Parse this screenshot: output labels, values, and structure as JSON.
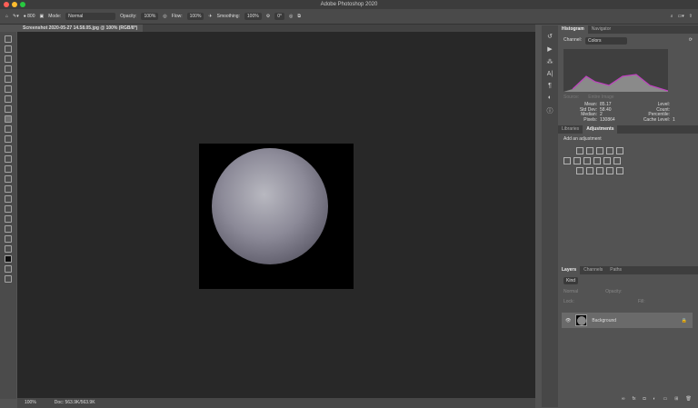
{
  "window": {
    "title": "Adobe Photoshop 2020"
  },
  "options": {
    "mode_label": "Mode:",
    "mode": "Normal",
    "opacity_label": "Opacity:",
    "opacity": "100%",
    "flow_label": "Flow:",
    "flow": "100%",
    "smoothing_label": "Smoothing:",
    "smoothing": "100%",
    "angle": "0°",
    "brush_size": "800"
  },
  "document": {
    "tab": "Screenshot 2020-05-27 14.58.05.jpg @ 100% (RGB/8*)"
  },
  "status": {
    "zoom": "100%",
    "doc": "Doc: 563.9K/563.9K"
  },
  "histogram": {
    "tabs": [
      "Histogram",
      "Navigator"
    ],
    "channel_label": "Channel:",
    "channel": "Colors",
    "source": "Entire Image",
    "stats": [
      [
        "Mean:",
        "85.17",
        "Level:",
        ""
      ],
      [
        "Std Dev:",
        "58.40",
        "Count:",
        ""
      ],
      [
        "Median:",
        "2",
        "Percentile:",
        ""
      ],
      [
        "Pixels:",
        "130864",
        "Cache Level:",
        "1"
      ]
    ]
  },
  "adjustments": {
    "tabs": [
      "Libraries",
      "Adjustments"
    ],
    "hint": "Add an adjustment"
  },
  "layers": {
    "tabs": [
      "Layers",
      "Channels",
      "Paths"
    ],
    "kind": "Kind",
    "blend": "Normal",
    "opacity_label": "Opacity:",
    "lock_label": "Lock:",
    "fill_label": "Fill:",
    "items": [
      {
        "name": "Background",
        "visible": true,
        "locked": true
      }
    ]
  },
  "colors": {
    "accent": "#535353",
    "canvas": "#282828"
  }
}
